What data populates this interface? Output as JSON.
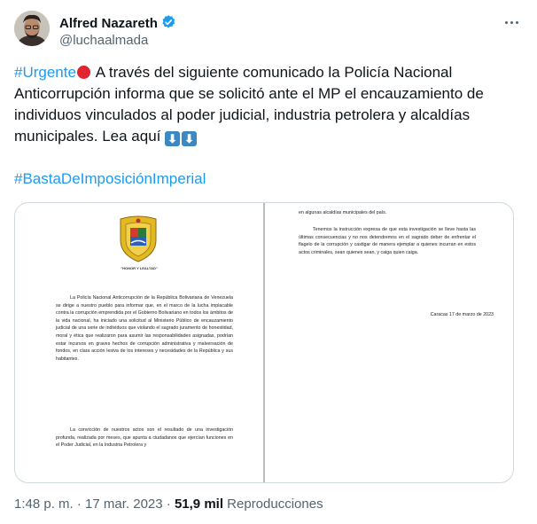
{
  "author": {
    "name": "Alfred Nazareth",
    "handle": "@luchaalmada"
  },
  "tweet": {
    "hashtag1": "#Urgente",
    "body": " A través del siguiente comunicado la Policía Nacional Anticorrupción informa que se solicitó ante el MP el encauzamiento de individuos vinculados al poder judicial, industria petrolera y alcaldías municipales. Lea aquí ",
    "arrow": "⬇",
    "hashtag2": "#BastaDeImposiciónImperial"
  },
  "document": {
    "motto": "\"HONOR Y LEALTAD\"",
    "left_p1": "La Policía Nacional Anticorrupción de la República Bolivariana de Venezuela se dirige a nuestro pueblo para informar que, en el marco de la lucha implacable contra la corrupción emprendida por el Gobierno Bolivariano en todos los ámbitos de la vida nacional, ha iniciado una solicitud al Ministerio Público de encauzamiento judicial de una serie de individuos que violando el sagrado juramento de honestidad, moral y ética que realizaron para asumir las responsabilidades asignadas, podrían estar incursos en graves hechos de corrupción administrativa y malversación de fondos, en clara acción lesiva de los intereses y necesidades de la República y sus habitantes.",
    "left_p2": "La convicción de nuestros actos son el resultado de una investigación profunda, realizada por meses, que apunta a ciudadanos que ejercían funciones en el Poder Judicial, en la Industria Petrolera y",
    "right_p1": "en algunas alcaldías municipales del país.",
    "right_p2": "Tenemos la instrucción expresa de que esta investigación se lleve hasta las últimas consecuencias y no nos detendremos en el sagrado deber de enfrentar el flagelo de la corrupción y castigar de manera ejemplar a quienes incurran en estos actos criminales, sean quienes sean, y caiga quien caiga.",
    "date": "Caracas 17 de marzo de 2023"
  },
  "meta": {
    "time": "1:48 p. m.",
    "date": "17 mar. 2023",
    "views_count": "51,9 mil",
    "views_label": "Reproducciones"
  },
  "colors": {
    "link": "#1d9bf0",
    "verified": "#1d9bf0",
    "secondary_text": "#536471"
  }
}
